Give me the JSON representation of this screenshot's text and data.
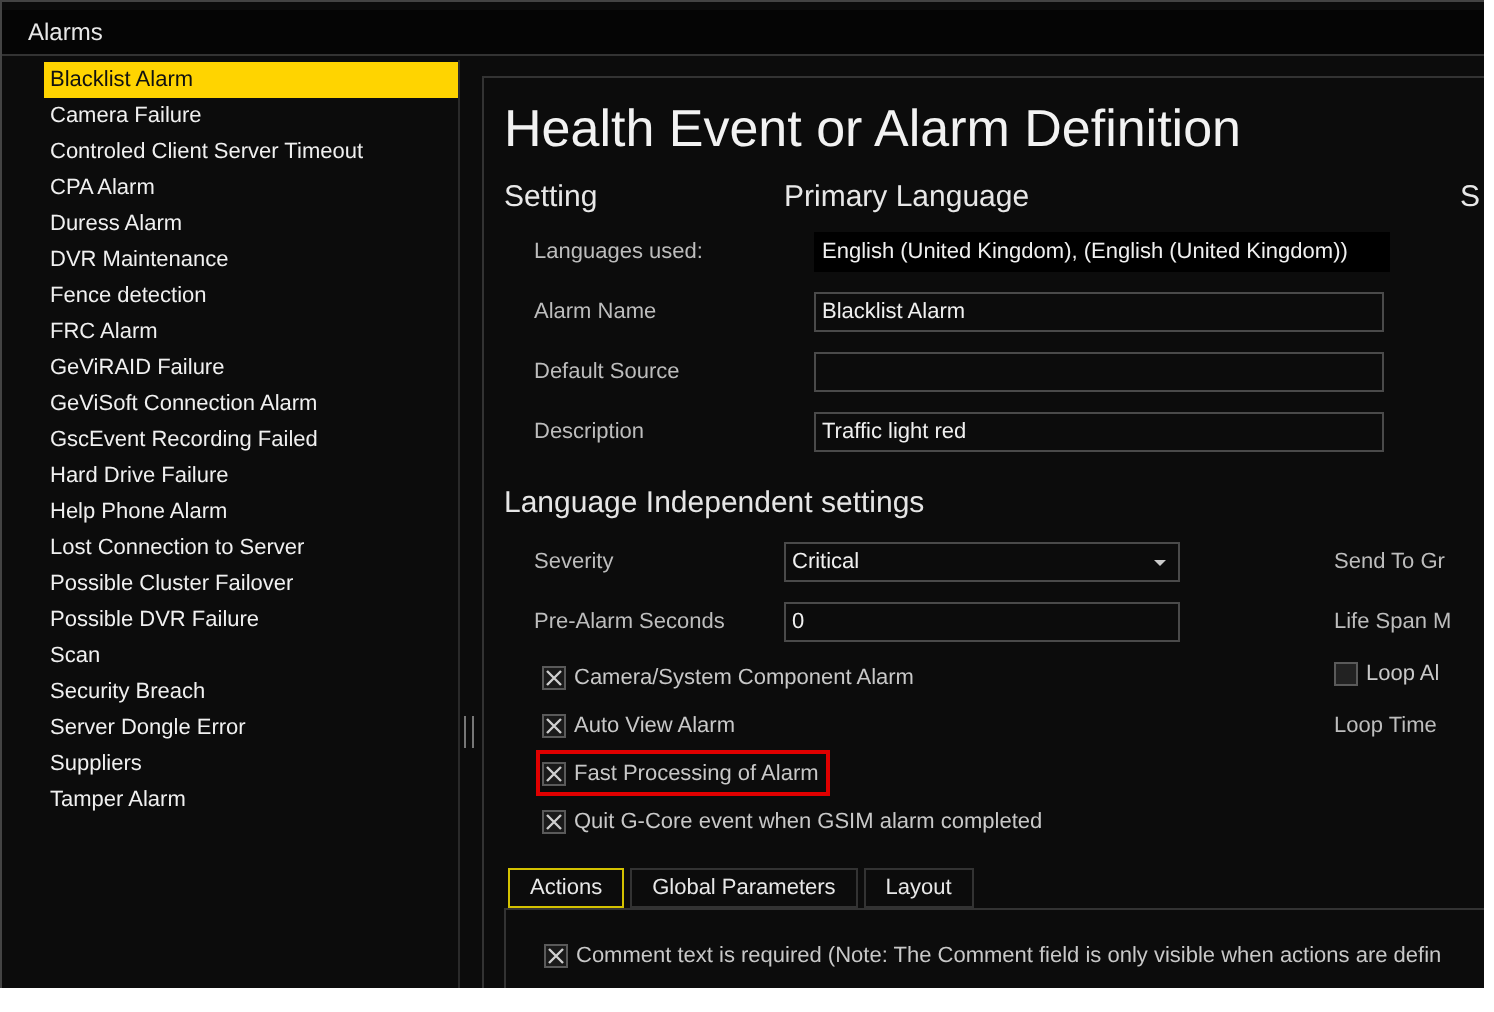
{
  "header": {
    "title": "Alarms"
  },
  "alarms": [
    {
      "label": "Blacklist Alarm",
      "selected": true
    },
    {
      "label": "Camera Failure",
      "selected": false
    },
    {
      "label": "Controled Client Server Timeout",
      "selected": false
    },
    {
      "label": "CPA Alarm",
      "selected": false
    },
    {
      "label": "Duress Alarm",
      "selected": false
    },
    {
      "label": "DVR Maintenance",
      "selected": false
    },
    {
      "label": "Fence detection",
      "selected": false
    },
    {
      "label": "FRC Alarm",
      "selected": false
    },
    {
      "label": "GeViRAID Failure",
      "selected": false
    },
    {
      "label": "GeViSoft Connection Alarm",
      "selected": false
    },
    {
      "label": "GscEvent Recording Failed",
      "selected": false
    },
    {
      "label": "Hard Drive Failure",
      "selected": false
    },
    {
      "label": "Help Phone Alarm",
      "selected": false
    },
    {
      "label": "Lost Connection to Server",
      "selected": false
    },
    {
      "label": "Possible Cluster Failover",
      "selected": false
    },
    {
      "label": "Possible DVR Failure",
      "selected": false
    },
    {
      "label": "Scan",
      "selected": false
    },
    {
      "label": "Security Breach",
      "selected": false
    },
    {
      "label": "Server Dongle Error",
      "selected": false
    },
    {
      "label": "Suppliers",
      "selected": false
    },
    {
      "label": "Tamper Alarm",
      "selected": false
    }
  ],
  "form": {
    "title": "Health Event or Alarm Definition",
    "columns": [
      "Setting",
      "Primary Language",
      "S"
    ],
    "language_rows": [
      {
        "label": "Languages used:",
        "value": "English (United Kingdom), (English (United Kingdom))",
        "kind": "readonly"
      },
      {
        "label": "Alarm Name",
        "value": "Blacklist Alarm",
        "kind": "input"
      },
      {
        "label": "Default Source",
        "kind": "input"
      },
      {
        "label": "Description",
        "value": "Traffic light red",
        "kind": "input"
      }
    ],
    "independent_title": "Language Independent settings",
    "independent_rows": [
      {
        "label": "Severity",
        "value": "Critical",
        "kind": "dropdown"
      },
      {
        "label": "Pre-Alarm Seconds",
        "value": "0",
        "kind": "input"
      }
    ],
    "options": [
      {
        "label": "Camera/System Component Alarm",
        "checked": true,
        "highlighted": false
      },
      {
        "label": "Auto View Alarm",
        "checked": true,
        "highlighted": false
      },
      {
        "label": "Fast Processing of Alarm",
        "checked": true,
        "highlighted": true
      },
      {
        "label": "Quit G-Core event when GSIM alarm completed",
        "checked": true,
        "highlighted": false
      }
    ],
    "right_column": [
      {
        "label": "Send To Gr",
        "kind": "text"
      },
      {
        "label": "Life Span M",
        "kind": "text"
      },
      {
        "label": "Loop Al",
        "kind": "checkbox",
        "checked": false
      },
      {
        "label": "Loop Time",
        "kind": "text"
      }
    ]
  },
  "tabs": [
    {
      "label": "Actions",
      "selected": true
    },
    {
      "label": "Global Parameters",
      "selected": false
    },
    {
      "label": "Layout",
      "selected": false
    }
  ],
  "actions": {
    "options": [
      {
        "label": "Comment text is required (Note: The Comment field is only visible when actions are defin",
        "checked": true
      }
    ]
  }
}
